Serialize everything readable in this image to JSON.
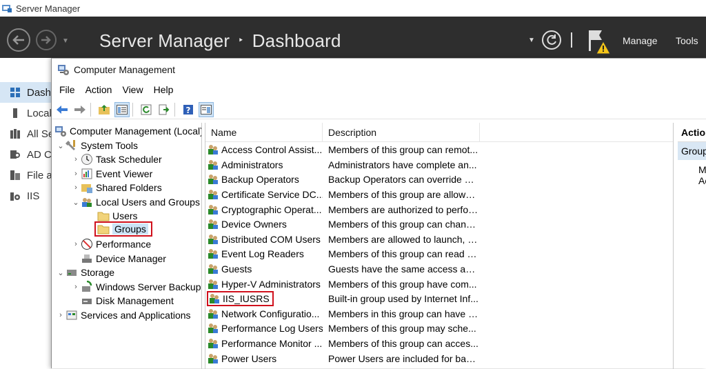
{
  "server_manager": {
    "window_title": "Server Manager",
    "header_title": "Server Manager",
    "breadcrumb_sep": "‣",
    "header_page": "Dashboard",
    "menu_manage": "Manage",
    "menu_tools": "Tools",
    "sidebar": [
      {
        "label": "Dashboard",
        "icon": "dashboard-icon"
      },
      {
        "label": "Local Server",
        "icon": "server-icon"
      },
      {
        "label": "All Servers",
        "icon": "servers-icon"
      },
      {
        "label": "AD CS",
        "icon": "certificate-icon"
      },
      {
        "label": "File and Storage Services",
        "icon": "file-icon"
      },
      {
        "label": "IIS",
        "icon": "iis-icon"
      }
    ]
  },
  "computer_management": {
    "window_title": "Computer Management",
    "menu": [
      "File",
      "Action",
      "View",
      "Help"
    ],
    "tree": {
      "root": "Computer Management (Local)",
      "system_tools": "System Tools",
      "task_scheduler": "Task Scheduler",
      "event_viewer": "Event Viewer",
      "shared_folders": "Shared Folders",
      "local_users_groups": "Local Users and Groups",
      "users": "Users",
      "groups": "Groups",
      "performance": "Performance",
      "device_manager": "Device Manager",
      "storage": "Storage",
      "windows_server_backup": "Windows Server Backup",
      "disk_management": "Disk Management",
      "services_apps": "Services and Applications"
    },
    "columns": {
      "name": "Name",
      "description": "Description"
    },
    "groups": [
      {
        "name": "Access Control Assist...",
        "description": "Members of this group can remot..."
      },
      {
        "name": "Administrators",
        "description": "Administrators have complete an..."
      },
      {
        "name": "Backup Operators",
        "description": "Backup Operators can override se..."
      },
      {
        "name": "Certificate Service DC...",
        "description": "Members of this group are allowe..."
      },
      {
        "name": "Cryptographic Operat...",
        "description": "Members are authorized to perfor..."
      },
      {
        "name": "Device Owners",
        "description": "Members of this group can chang..."
      },
      {
        "name": "Distributed COM Users",
        "description": "Members are allowed to launch, a..."
      },
      {
        "name": "Event Log Readers",
        "description": "Members of this group can read e..."
      },
      {
        "name": "Guests",
        "description": "Guests have the same access as m..."
      },
      {
        "name": "Hyper-V Administrators",
        "description": "Members of this group have com..."
      },
      {
        "name": "IIS_IUSRS",
        "description": "Built-in group used by Internet Inf..."
      },
      {
        "name": "Network Configuratio...",
        "description": "Members in this group can have s..."
      },
      {
        "name": "Performance Log Users",
        "description": "Members of this group may sche..."
      },
      {
        "name": "Performance Monitor ...",
        "description": "Members of this group can acces..."
      },
      {
        "name": "Power Users",
        "description": "Power Users are included for back..."
      }
    ],
    "actions": {
      "header": "Actions",
      "sub": "Groups",
      "item": "More Actions"
    }
  }
}
